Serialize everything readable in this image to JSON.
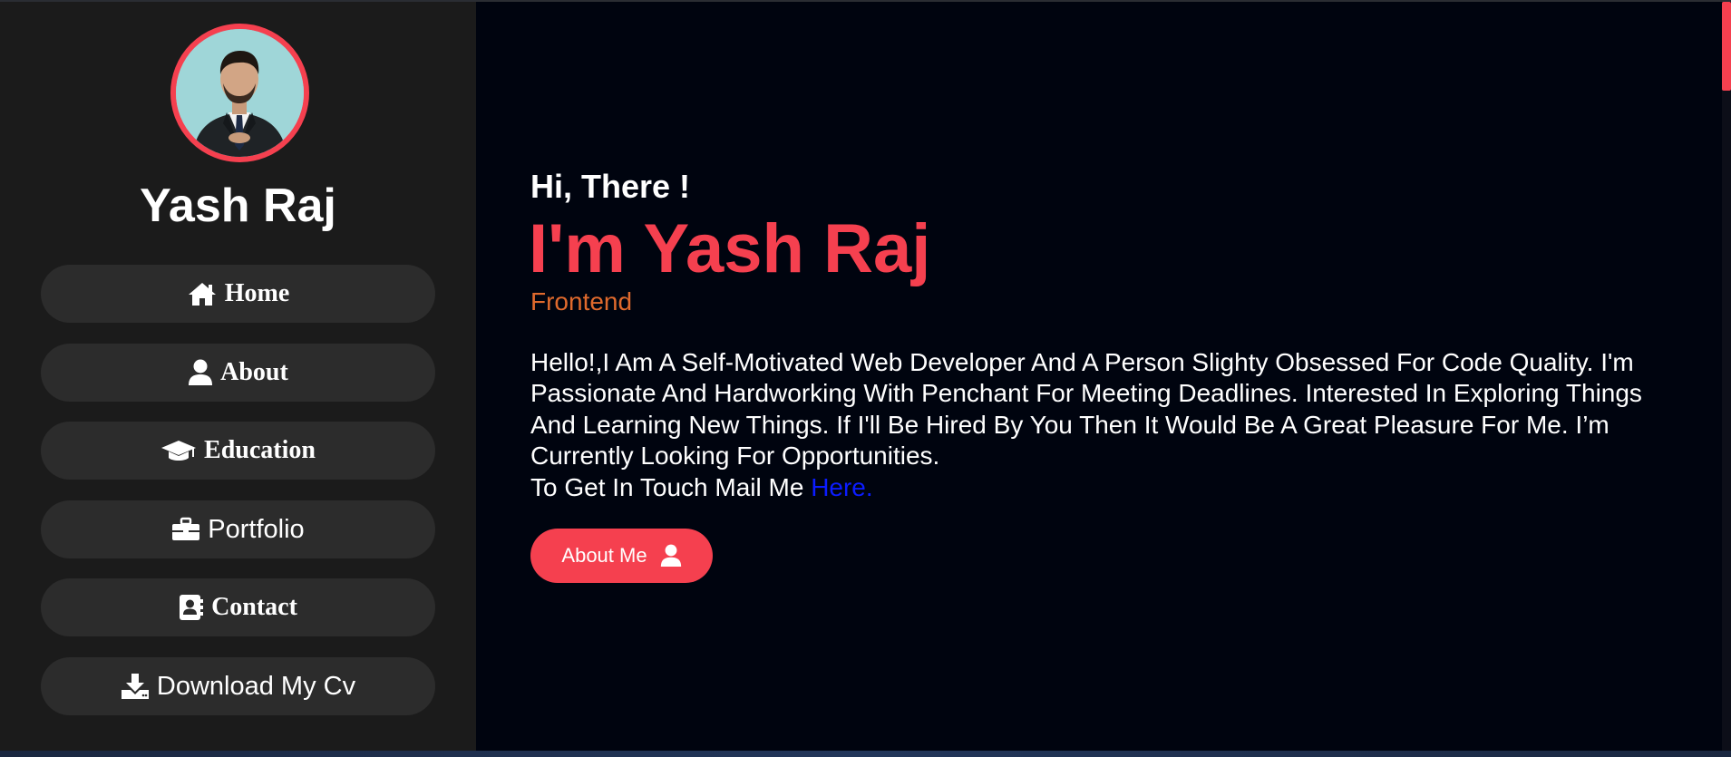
{
  "sidebar": {
    "profile_name": "Yash Raj",
    "nav": [
      {
        "label": "Home",
        "icon": "home-icon"
      },
      {
        "label": "About",
        "icon": "user-icon"
      },
      {
        "label": "Education",
        "icon": "graduation-cap-icon"
      },
      {
        "label": "Portfolio",
        "icon": "briefcase-icon"
      },
      {
        "label": "Contact",
        "icon": "address-book-icon"
      },
      {
        "label": "Download My Cv",
        "icon": "download-icon"
      }
    ]
  },
  "hero": {
    "greeting": "Hi, There !",
    "headline": "I'm Yash Raj",
    "role": "Frontend",
    "bio": "Hello!,I Am A Self-Motivated Web Developer And A Person Slighty Obsessed For Code Quality. I'm Passionate And Hardworking With Penchant For Meeting Deadlines. Interested In Exploring Things And Learning New Things. If I'll Be Hired By You Then It Would Be A Great Pleasure For Me. I’m Currently Looking For Opportunities.",
    "contact_prefix": "To Get In Touch Mail Me",
    "contact_link": "Here.",
    "cta_label": "About Me",
    "cta_icon": "user-icon"
  },
  "colors": {
    "accent": "#f5404f",
    "sidebar_bg": "#1b1b1b",
    "main_bg": "#00040f",
    "nav_button_bg": "#2c2c2c",
    "role_text": "#e06a2d",
    "link": "#0b1cff"
  }
}
